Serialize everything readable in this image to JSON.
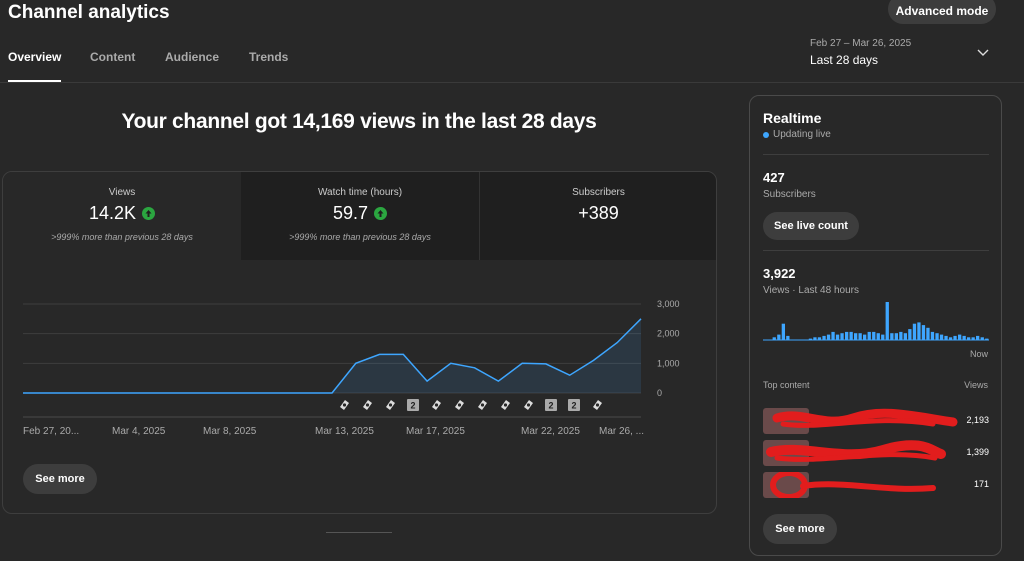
{
  "header": {
    "title": "Channel analytics",
    "advanced_mode_label": "Advanced mode",
    "tabs": [
      {
        "label": "Overview",
        "active": true
      },
      {
        "label": "Content",
        "active": false
      },
      {
        "label": "Audience",
        "active": false
      },
      {
        "label": "Trends",
        "active": false
      }
    ],
    "date_range": {
      "range": "Feb 27 – Mar 26, 2025",
      "label": "Last 28 days"
    }
  },
  "main": {
    "headline": "Your channel got 14,169 views in the last 28 days",
    "stats": [
      {
        "label": "Views",
        "value": "14.2K",
        "trend": "up",
        "note": ">999% more than previous 28 days"
      },
      {
        "label": "Watch time (hours)",
        "value": "59.7",
        "trend": "up",
        "note": ">999% more than previous 28 days"
      },
      {
        "label": "Subscribers",
        "value": "+389",
        "trend": "",
        "note": ""
      }
    ],
    "see_more_label": "See more"
  },
  "chart_data": {
    "type": "area",
    "series": [
      {
        "values": [
          0,
          0,
          0,
          0,
          0,
          0,
          0,
          0,
          0,
          0,
          0,
          0,
          0,
          0,
          1000,
          1300,
          1300,
          400,
          1000,
          850,
          400,
          1000,
          980,
          600,
          1100,
          1700,
          2500
        ]
      }
    ],
    "x_tick_labels": [
      "Feb 27, 20...",
      "Mar 4, 2025",
      "Mar 8, 2025",
      "Mar 13, 2025",
      "Mar 17, 2025",
      "Mar 22, 2025",
      "Mar 26, ..."
    ],
    "y_ticks": [
      "3,000",
      "2,000",
      "1,000",
      "0"
    ],
    "ylim": [
      0,
      3000
    ],
    "grid": true,
    "accent": "#3ea6ff",
    "markers": [
      {
        "type": "short"
      },
      {
        "type": "short"
      },
      {
        "type": "short"
      },
      {
        "type": "count",
        "label": "2"
      },
      {
        "type": "short"
      },
      {
        "type": "short"
      },
      {
        "type": "short"
      },
      {
        "type": "short"
      },
      {
        "type": "short"
      },
      {
        "type": "count",
        "label": "2"
      },
      {
        "type": "count",
        "label": "2"
      },
      {
        "type": "short"
      }
    ]
  },
  "realtime": {
    "title": "Realtime",
    "status": "Updating live",
    "subscribers_value": "427",
    "subscribers_label": "Subscribers",
    "live_count_label": "See live count",
    "views_value": "3,922",
    "views_label": "Views · Last 48 hours",
    "now_label": "Now",
    "bars": [
      0,
      0,
      2,
      4,
      12,
      3,
      0,
      0,
      0,
      0,
      1,
      2,
      2,
      3,
      4,
      6,
      4,
      5,
      6,
      6,
      5,
      5,
      4,
      6,
      6,
      5,
      4,
      28,
      5,
      5,
      6,
      5,
      8,
      12,
      13,
      11,
      9,
      6,
      5,
      4,
      3,
      2,
      3,
      4,
      3,
      2,
      2,
      3,
      2,
      1
    ],
    "top_content_label": "Top content",
    "views_col_label": "Views",
    "top_content": [
      {
        "title": "",
        "views": "2,193"
      },
      {
        "title": "",
        "views": "1,399"
      },
      {
        "title": "",
        "views": "171"
      }
    ],
    "see_more_label": "See more"
  }
}
